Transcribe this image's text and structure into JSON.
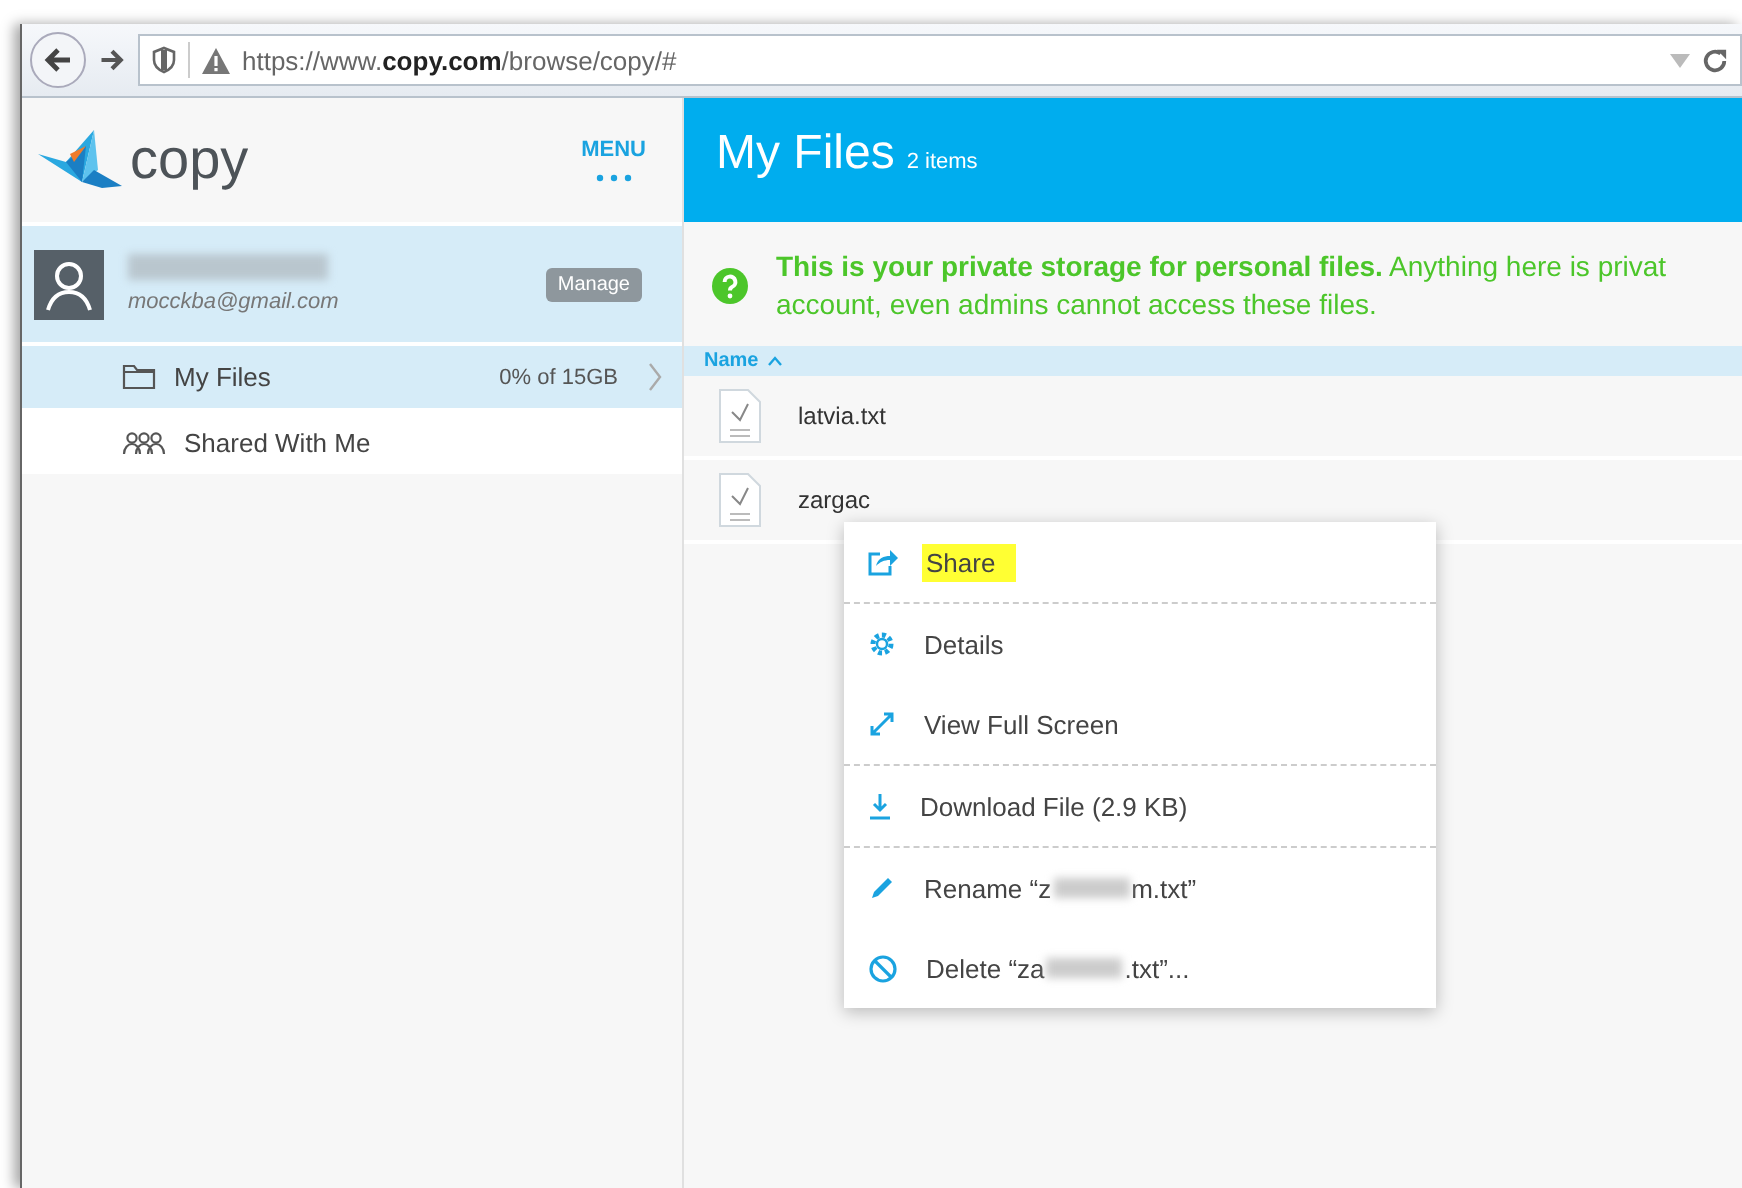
{
  "browser": {
    "url_prefix": "https://www.",
    "url_domain": "copy.com",
    "url_path": "/browse/copy/#"
  },
  "sidebar": {
    "logo_text": "copy",
    "menu_label": "MENU",
    "user": {
      "email": "mocckba@gmail.com",
      "manage_button": "Manage"
    },
    "items": [
      {
        "kind": "folder",
        "label": "My Files",
        "quota": "0% of 15GB",
        "selected": true
      },
      {
        "kind": "shared",
        "label": "Shared With Me",
        "selected": false
      }
    ]
  },
  "main": {
    "title": "My Files",
    "count": "2 items",
    "notice_bold": "This is your private storage for personal files.",
    "notice_rest": " Anything here is privat",
    "notice_line2": "account, even admins cannot access these files.",
    "sort_column": "Name",
    "files": [
      {
        "name": "latvia.txt"
      },
      {
        "name": "zargac"
      }
    ]
  },
  "context_menu": [
    {
      "kind": "share",
      "label": "Share",
      "highlighted": true,
      "divider_before": false
    },
    {
      "kind": "details",
      "label": "Details",
      "highlighted": false,
      "divider_before": true
    },
    {
      "kind": "fullscreen",
      "label": "View Full Screen",
      "highlighted": false,
      "divider_before": false
    },
    {
      "kind": "download",
      "label": "Download File (2.9 KB)",
      "highlighted": false,
      "divider_before": true
    },
    {
      "kind": "rename",
      "label": "Rename “z",
      "label_end": "m.txt”",
      "highlighted": false,
      "divider_before": true
    },
    {
      "kind": "delete",
      "label": "Delete “za",
      "label_end": ".txt”...",
      "highlighted": false,
      "divider_before": false
    }
  ]
}
